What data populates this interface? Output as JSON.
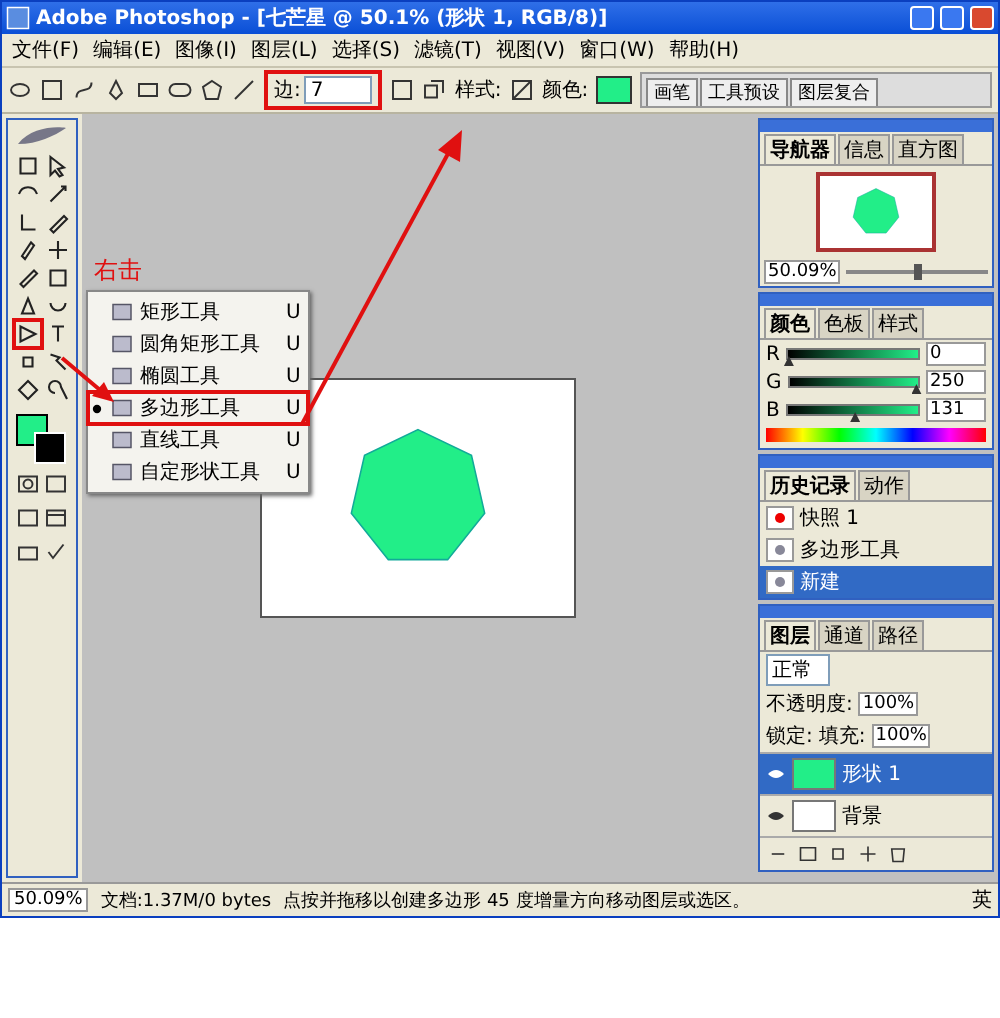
{
  "window": {
    "title": "Adobe Photoshop - [七芒星 @ 50.1% (形状 1, RGB/8)]"
  },
  "menu": [
    "文件(F)",
    "编辑(E)",
    "图像(I)",
    "图层(L)",
    "选择(S)",
    "滤镜(T)",
    "视图(V)",
    "窗口(W)",
    "帮助(H)"
  ],
  "options": {
    "sides_label": "边:",
    "sides_value": "7",
    "style_label": "样式:",
    "color_label": "颜色:"
  },
  "palette_well": [
    "画笔",
    "工具预设",
    "图层复合"
  ],
  "annotation": "右击",
  "context_menu": [
    {
      "label": "矩形工具",
      "shortcut": "U",
      "selected": false
    },
    {
      "label": "圆角矩形工具",
      "shortcut": "U",
      "selected": false
    },
    {
      "label": "椭圆工具",
      "shortcut": "U",
      "selected": false
    },
    {
      "label": "多边形工具",
      "shortcut": "U",
      "selected": true
    },
    {
      "label": "直线工具",
      "shortcut": "U",
      "selected": false
    },
    {
      "label": "自定形状工具",
      "shortcut": "U",
      "selected": false
    }
  ],
  "navigator": {
    "tabs": [
      {
        "label": "导航器",
        "selected": true
      },
      {
        "label": "信息",
        "selected": false
      },
      {
        "label": "直方图",
        "selected": false
      }
    ],
    "zoom": "50.09%",
    "zoom_slider": {
      "level": 0.5
    }
  },
  "color_panel": {
    "tabs": [
      {
        "label": "颜色",
        "selected": true
      },
      {
        "label": "色板",
        "selected": false
      },
      {
        "label": "样式",
        "selected": false
      }
    ],
    "channels": [
      {
        "name": "R",
        "value": "0",
        "level": 0
      },
      {
        "name": "G",
        "value": "250",
        "level": 0.98
      },
      {
        "name": "B",
        "value": "131",
        "level": 0.51
      }
    ]
  },
  "history": {
    "tabs": [
      {
        "label": "历史记录",
        "selected": true
      },
      {
        "label": "动作",
        "selected": false
      }
    ],
    "items": [
      {
        "label": "快照 1",
        "selected": false
      },
      {
        "label": "多边形工具",
        "selected": false
      },
      {
        "label": "新建",
        "selected": true
      }
    ]
  },
  "layers": {
    "tabs": [
      {
        "label": "图层",
        "selected": true
      },
      {
        "label": "通道",
        "selected": false
      },
      {
        "label": "路径",
        "selected": false
      }
    ],
    "blend": "正常",
    "opacity_label": "不透明度:",
    "opacity": "100%",
    "lock_label": "锁定:",
    "fill_label": "填充:",
    "fill": "100%",
    "items": [
      {
        "name": "形状 1",
        "selected": true,
        "visible": true
      },
      {
        "name": "背景",
        "selected": false,
        "visible": true
      }
    ]
  },
  "status_bar": {
    "zoom": "50.09%",
    "doc": "文档:1.37M/0 bytes",
    "hint": "点按并拖移以创建多边形 45 度增量方向移动图层或选区。",
    "ime": "英"
  }
}
